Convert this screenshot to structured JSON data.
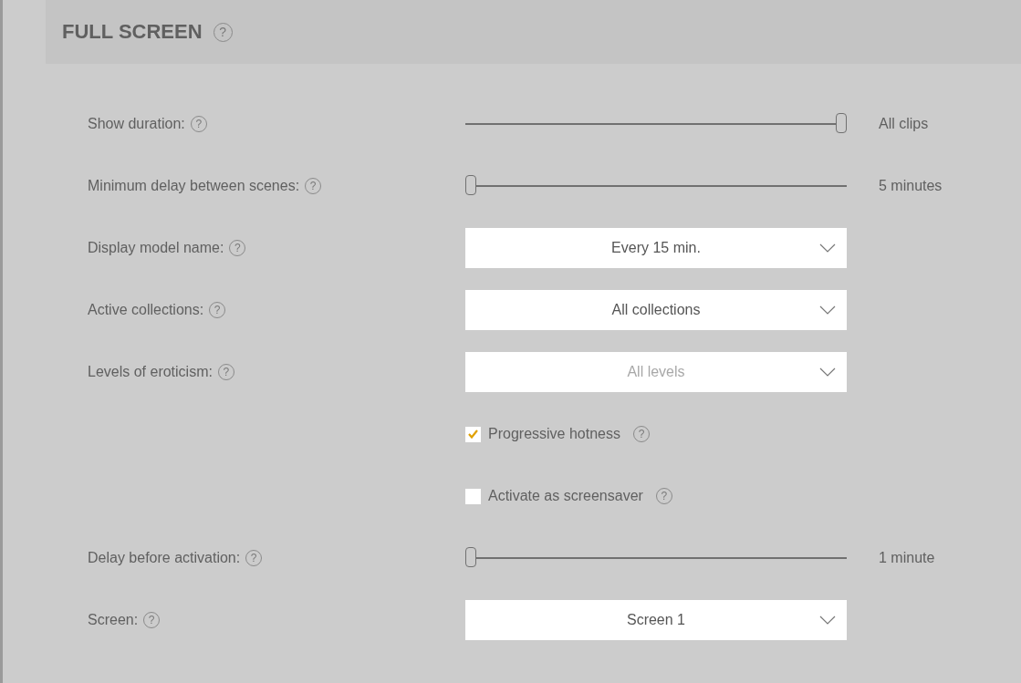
{
  "section": {
    "title": "FULL SCREEN",
    "help": "?"
  },
  "settings": [
    {
      "kind": "slider",
      "label": "Show duration:",
      "help": "?",
      "level": 1,
      "reading": "All clips"
    },
    {
      "kind": "slider",
      "label": "Minimum delay between scenes:",
      "help": "?",
      "level": 0,
      "reading": "5 minutes"
    },
    {
      "kind": "dropdown",
      "label": "Display model name:",
      "help": "?",
      "value": "Every 15 min.",
      "disabled": false
    },
    {
      "kind": "dropdown",
      "label": "Active collections:",
      "help": "?",
      "value": "All collections",
      "disabled": false
    },
    {
      "kind": "dropdown",
      "label": "Levels of eroticism:",
      "help": "?",
      "value": "All levels",
      "disabled": true
    },
    {
      "kind": "checkbox",
      "label": "Progressive hotness",
      "help": "?",
      "checked": true
    },
    {
      "kind": "checkbox",
      "label": "Activate as screensaver",
      "help": "?",
      "checked": false
    },
    {
      "kind": "slider",
      "label": "Delay before activation:",
      "help": "?",
      "level": 0,
      "reading": "1 minute"
    },
    {
      "kind": "dropdown",
      "label": "Screen:",
      "help": "?",
      "value": "Screen 1",
      "disabled": false
    }
  ]
}
